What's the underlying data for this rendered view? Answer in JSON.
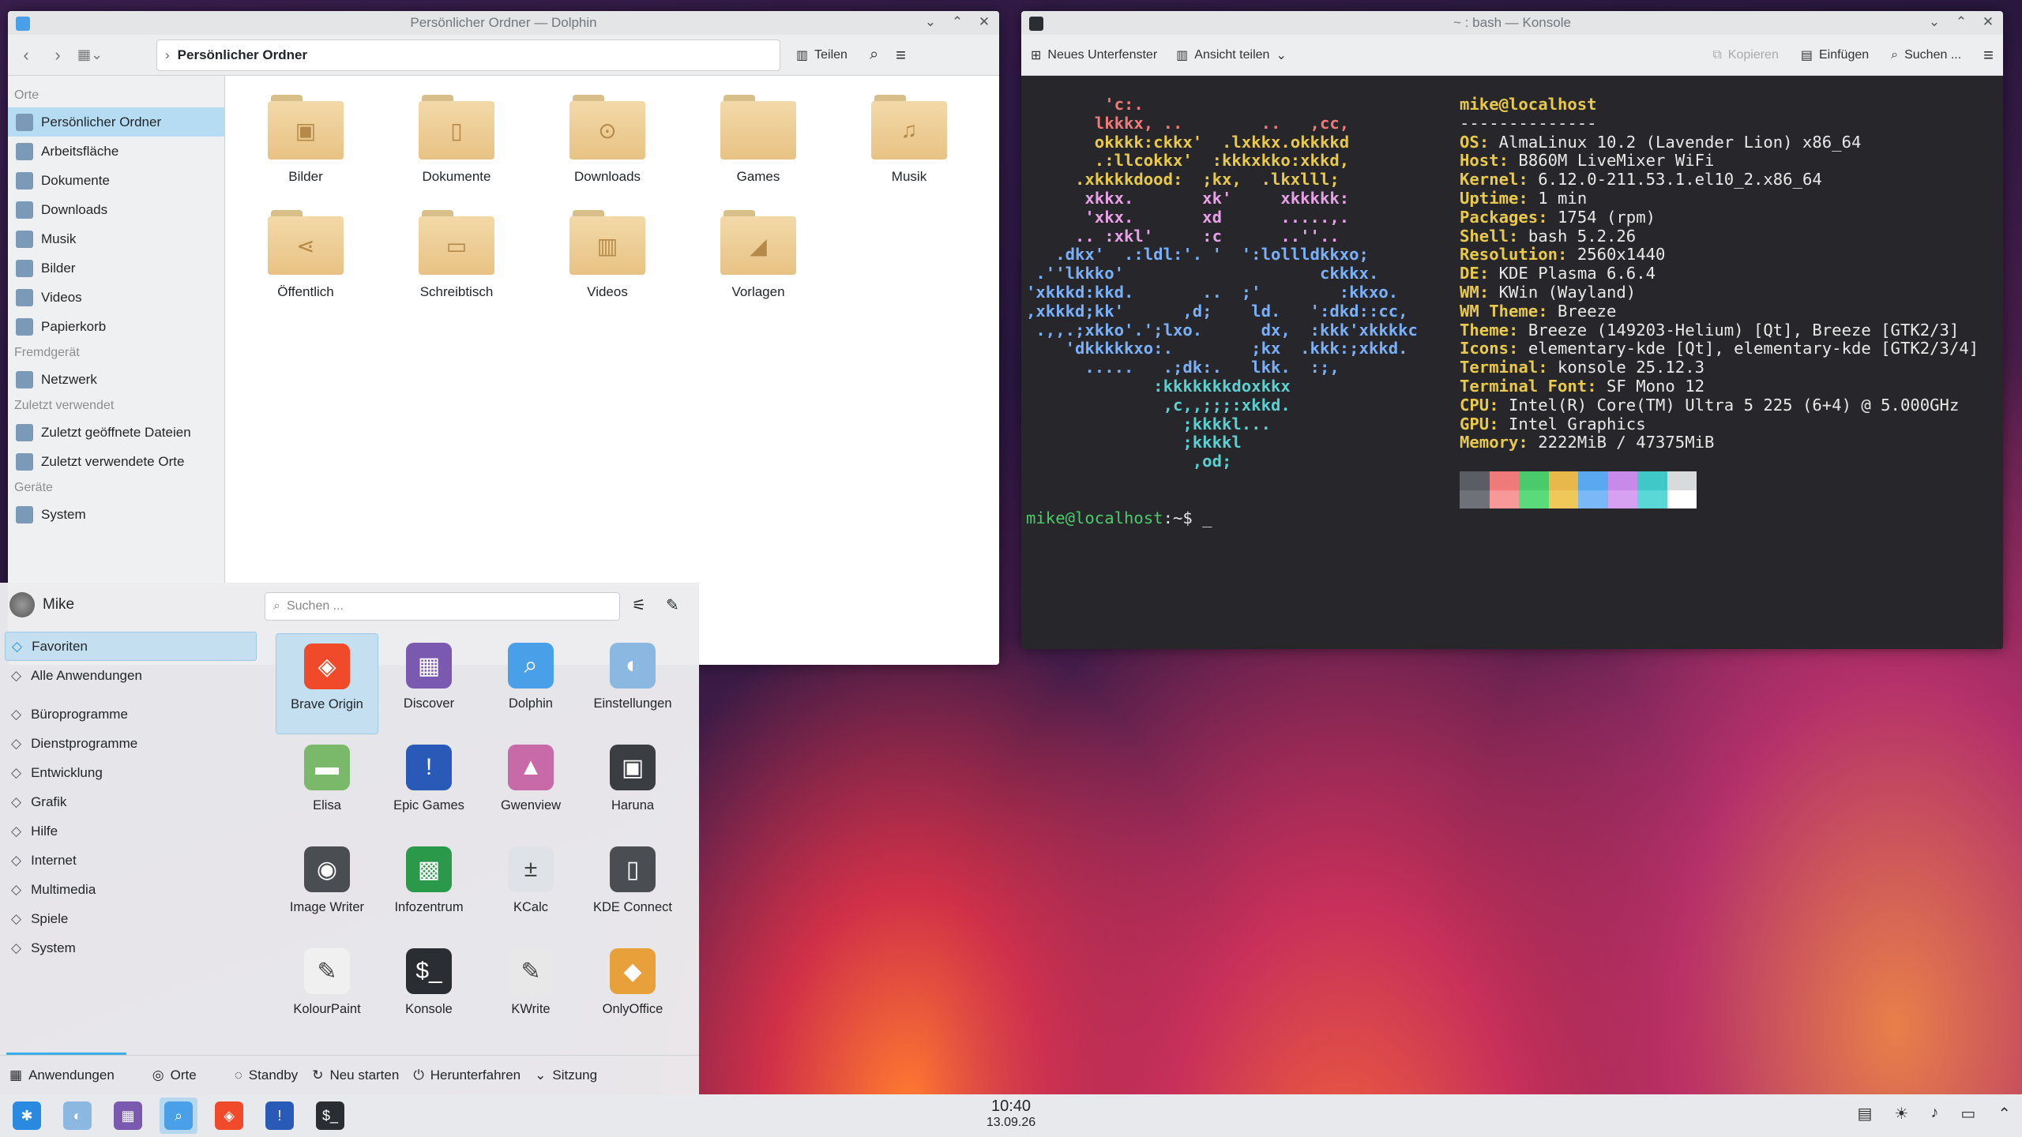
{
  "dolphin": {
    "title": "Persönlicher Ordner — Dolphin",
    "breadcrumb": "Persönlicher Ordner",
    "split_label": "Teilen",
    "places": [
      {
        "section": "Orte"
      },
      {
        "label": "Persönlicher Ordner",
        "icon": "home-icon",
        "selected": true
      },
      {
        "label": "Arbeitsfläche",
        "icon": "desktop-icon"
      },
      {
        "label": "Dokumente",
        "icon": "document-icon"
      },
      {
        "label": "Downloads",
        "icon": "download-icon"
      },
      {
        "label": "Musik",
        "icon": "music-icon"
      },
      {
        "label": "Bilder",
        "icon": "image-icon"
      },
      {
        "label": "Videos",
        "icon": "video-icon"
      },
      {
        "label": "Papierkorb",
        "icon": "trash-icon"
      },
      {
        "section": "Fremdgerät"
      },
      {
        "label": "Netzwerk",
        "icon": "network-icon"
      },
      {
        "section": "Zuletzt verwendet"
      },
      {
        "label": "Zuletzt geöffnete Dateien",
        "icon": "recent-files-icon"
      },
      {
        "label": "Zuletzt verwendete Orte",
        "icon": "recent-places-icon"
      },
      {
        "section": "Geräte"
      },
      {
        "label": "System",
        "icon": "drive-icon"
      }
    ],
    "folders": [
      {
        "label": "Bilder",
        "glyph": "▣"
      },
      {
        "label": "Dokumente",
        "glyph": "▯"
      },
      {
        "label": "Downloads",
        "glyph": "⊙"
      },
      {
        "label": "Games",
        "glyph": ""
      },
      {
        "label": "Musik",
        "glyph": "♫"
      },
      {
        "label": "Öffentlich",
        "glyph": "⋖"
      },
      {
        "label": "Schreibtisch",
        "glyph": "▭"
      },
      {
        "label": "Videos",
        "glyph": "▥"
      },
      {
        "label": "Vorlagen",
        "glyph": "◢"
      }
    ]
  },
  "konsole": {
    "title": "~ : bash — Konsole",
    "new_tab": "Neues Unterfenster",
    "split": "Ansicht teilen",
    "copy": "Kopieren",
    "paste": "Einfügen",
    "find": "Suchen ...",
    "logo_lines": [
      {
        "t": "        'c:.",
        "c": "#f07a7a"
      },
      {
        "t": "       lkkkx, ..        ..   ,cc,",
        "c": "#f07a7a"
      },
      {
        "t": "       okkkk:ckkx'  .lxkkx.okkkkd",
        "c": "#e8c94a"
      },
      {
        "t": "       .:llcokkx'  :kkkxkko:xkkd,",
        "c": "#e8c94a"
      },
      {
        "t": "     .xkkkkdood:  ;kx,  .lkxlll;",
        "c": "#e8c94a"
      },
      {
        "t": "      xkkx.       xk'     xkkkkk:",
        "c": "#e8a0e8"
      },
      {
        "t": "      'xkx.       xd      .....,.",
        "c": "#e8a0e8"
      },
      {
        "t": "     .. :xkl'     :c      ..''..",
        "c": "#e8a0e8"
      },
      {
        "t": "   .dkx'  .:ldl:'. '  ':lollldkkxo;",
        "c": "#7ab0f8"
      },
      {
        "t": " .''lkkko'                    ckkkx.",
        "c": "#7ab0f8"
      },
      {
        "t": "'xkkkd:kkd.       ..  ;'        :kkxo.",
        "c": "#7ab0f8"
      },
      {
        "t": ",xkkkd;kk'      ,d;    ld.   ':dkd::cc,",
        "c": "#7ab0f8"
      },
      {
        "t": " .,,.;xkko'.';lxo.      dx,  :kkk'xkkkkc",
        "c": "#7ab0f8"
      },
      {
        "t": "    'dkkkkkxo:.        ;kx  .kkk:;xkkd.",
        "c": "#7ab0f8"
      },
      {
        "t": "      .....   .;dk:.   lkk.  :;,",
        "c": "#7ab0f8"
      },
      {
        "t": "             :kkkkkkkdoxkkx",
        "c": "#5ad0d0"
      },
      {
        "t": "              ,c,,;;;:xkkd.",
        "c": "#5ad0d0"
      },
      {
        "t": "                ;kkkkl...",
        "c": "#5ad0d0"
      },
      {
        "t": "                ;kkkkl",
        "c": "#5ad0d0"
      },
      {
        "t": "                 ,od;",
        "c": "#5ad0d0"
      }
    ],
    "user_host": "mike@localhost",
    "separator": "--------------",
    "info": [
      {
        "k": "OS",
        "v": "AlmaLinux 10.2 (Lavender Lion) x86_64"
      },
      {
        "k": "Host",
        "v": "B860M LiveMixer WiFi"
      },
      {
        "k": "Kernel",
        "v": "6.12.0-211.53.1.el10_2.x86_64"
      },
      {
        "k": "Uptime",
        "v": "1 min"
      },
      {
        "k": "Packages",
        "v": "1754 (rpm)"
      },
      {
        "k": "Shell",
        "v": "bash 5.2.26"
      },
      {
        "k": "Resolution",
        "v": "2560x1440"
      },
      {
        "k": "DE",
        "v": "KDE Plasma 6.6.4"
      },
      {
        "k": "WM",
        "v": "KWin (Wayland)"
      },
      {
        "k": "WM Theme",
        "v": "Breeze"
      },
      {
        "k": "Theme",
        "v": "Breeze (149203-Helium) [Qt], Breeze [GTK2/3]"
      },
      {
        "k": "Icons",
        "v": "elementary-kde [Qt], elementary-kde [GTK2/3/4]"
      },
      {
        "k": "Terminal",
        "v": "konsole 25.12.3"
      },
      {
        "k": "Terminal Font",
        "v": "SF Mono 12"
      },
      {
        "k": "CPU",
        "v": "Intel(R) Core(TM) Ultra 5 225 (6+4) @ 5.000GHz"
      },
      {
        "k": "GPU",
        "v": "Intel Graphics"
      },
      {
        "k": "Memory",
        "v": "2222MiB / 47375MiB"
      }
    ],
    "palette_top": [
      "#5a5d63",
      "#f07a7a",
      "#4aca6a",
      "#e8b84a",
      "#5aa8f0",
      "#c88ae8",
      "#40c8c8",
      "#d8dadc"
    ],
    "palette_bottom": [
      "#6e7178",
      "#f89898",
      "#5ada7a",
      "#f0c85a",
      "#7ab8f8",
      "#d8a0f0",
      "#5ad8d8",
      "#ffffff"
    ],
    "prompt_user": "mike@localhost",
    "prompt_path": ":~$",
    "cursor": " _"
  },
  "launcher": {
    "user": "Mike",
    "search_placeholder": "Suchen ...",
    "categories": [
      {
        "label": "Favoriten",
        "icon": "bookmark-icon",
        "selected": true
      },
      {
        "label": "Alle Anwendungen",
        "icon": "all-apps-icon"
      },
      {
        "spacer": true
      },
      {
        "label": "Büroprogramme",
        "icon": "office-icon"
      },
      {
        "label": "Dienstprogramme",
        "icon": "utilities-icon"
      },
      {
        "label": "Entwicklung",
        "icon": "development-icon"
      },
      {
        "label": "Grafik",
        "icon": "graphics-icon"
      },
      {
        "label": "Hilfe",
        "icon": "help-icon"
      },
      {
        "label": "Internet",
        "icon": "internet-icon"
      },
      {
        "label": "Multimedia",
        "icon": "multimedia-icon"
      },
      {
        "label": "Spiele",
        "icon": "games-icon"
      },
      {
        "label": "System",
        "icon": "system-icon"
      }
    ],
    "apps": [
      {
        "label": "Brave Origin",
        "color": "#f04a2a",
        "glyph": "◈",
        "selected": true
      },
      {
        "label": "Discover",
        "color": "#7a5ab0",
        "glyph": "▦"
      },
      {
        "label": "Dolphin",
        "color": "#4aa0e8",
        "glyph": "⌕"
      },
      {
        "label": "Einstellungen",
        "color": "#8ab8e0",
        "glyph": "◐"
      },
      {
        "label": "Elisa",
        "color": "#7ab86a",
        "glyph": "▬"
      },
      {
        "label": "Epic Games",
        "color": "#2a5ab8",
        "glyph": "!"
      },
      {
        "label": "Gwenview",
        "color": "#c86aa8",
        "glyph": "▲"
      },
      {
        "label": "Haruna",
        "color": "#3a3d42",
        "glyph": "▣"
      },
      {
        "label": "Image Writer",
        "color": "#4a4d52",
        "glyph": "◉"
      },
      {
        "label": "Infozentrum",
        "color": "#2a9a4a",
        "glyph": "▩"
      },
      {
        "label": "KCalc",
        "color": "#dfe3e8",
        "glyph": "±"
      },
      {
        "label": "KDE Connect",
        "color": "#4a4d52",
        "glyph": "▯"
      },
      {
        "label": "KolourPaint",
        "color": "#f0f0f0",
        "glyph": "✎"
      },
      {
        "label": "Konsole",
        "color": "#2a2d32",
        "glyph": "$_"
      },
      {
        "label": "KWrite",
        "color": "#e8e8e8",
        "glyph": "✎"
      },
      {
        "label": "OnlyOffice",
        "color": "#e8a03a",
        "glyph": "◆"
      }
    ],
    "footer": [
      {
        "label": "Anwendungen",
        "icon": "apps-icon"
      },
      {
        "label": "Orte",
        "icon": "places-icon"
      },
      {
        "label": "Standby",
        "icon": "sleep-icon"
      },
      {
        "label": "Neu starten",
        "icon": "restart-icon"
      },
      {
        "label": "Herunterfahren",
        "icon": "shutdown-icon"
      },
      {
        "label": "Sitzung",
        "icon": "session-icon"
      }
    ]
  },
  "taskbar": {
    "time": "10:40",
    "date": "13.09.26",
    "items": [
      {
        "name": "app-launcher",
        "color": "#2a8ae0",
        "glyph": "✱"
      },
      {
        "name": "settings",
        "color": "#8ab8e0",
        "glyph": "◐"
      },
      {
        "name": "discover",
        "color": "#7a5ab0",
        "glyph": "▦"
      },
      {
        "name": "dolphin",
        "color": "#4aa0e8",
        "glyph": "⌕",
        "active": true
      },
      {
        "name": "brave",
        "color": "#f04a2a",
        "glyph": "◈"
      },
      {
        "name": "epic-games",
        "color": "#2a5ab8",
        "glyph": "!"
      },
      {
        "name": "konsole",
        "color": "#2a2d32",
        "glyph": "$_"
      }
    ],
    "tray": [
      "clipboard-icon",
      "brightness-icon",
      "volume-icon",
      "display-icon",
      "expand-tray-icon"
    ]
  }
}
